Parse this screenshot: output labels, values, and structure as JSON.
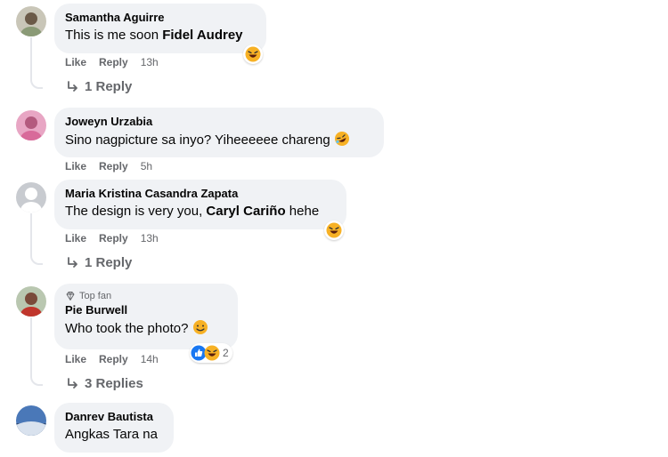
{
  "comments": [
    {
      "author": "Samantha Aguirre",
      "text_prefix": "This is me soon ",
      "mention": "Fidel Audrey",
      "like": "Like",
      "reply": "Reply",
      "time": "13h",
      "replies": "1 Reply",
      "reaction": "laughing-emoji"
    },
    {
      "author": "Joweyn Urzabia",
      "text_prefix": "Sino nagpicture sa inyo? Yiheeeeee chareng",
      "like": "Like",
      "reply": "Reply",
      "time": "5h",
      "inline_emoji": "rofl-emoji"
    },
    {
      "author": "Maria Kristina Casandra Zapata",
      "text_prefix": "The design is very you, ",
      "mention": "Caryl Cariño",
      "text_suffix": " hehe",
      "like": "Like",
      "reply": "Reply",
      "time": "13h",
      "replies": "1 Reply",
      "reaction": "laughing-emoji"
    },
    {
      "badge": "Top fan",
      "author": "Pie Burwell",
      "text_prefix": "Who took the photo?",
      "like": "Like",
      "reply": "Reply",
      "time": "14h",
      "replies": "3 Replies",
      "reaction_count": "2",
      "inline_emoji": "smile-emoji"
    },
    {
      "author": "Danrev Bautista",
      "text_prefix": "Angkas Tara na"
    }
  ],
  "colors": {
    "bubble": "#f0f2f5",
    "muted": "#65676b",
    "like_blue": "#1877f2",
    "emoji_yellow": "#f7b125"
  }
}
